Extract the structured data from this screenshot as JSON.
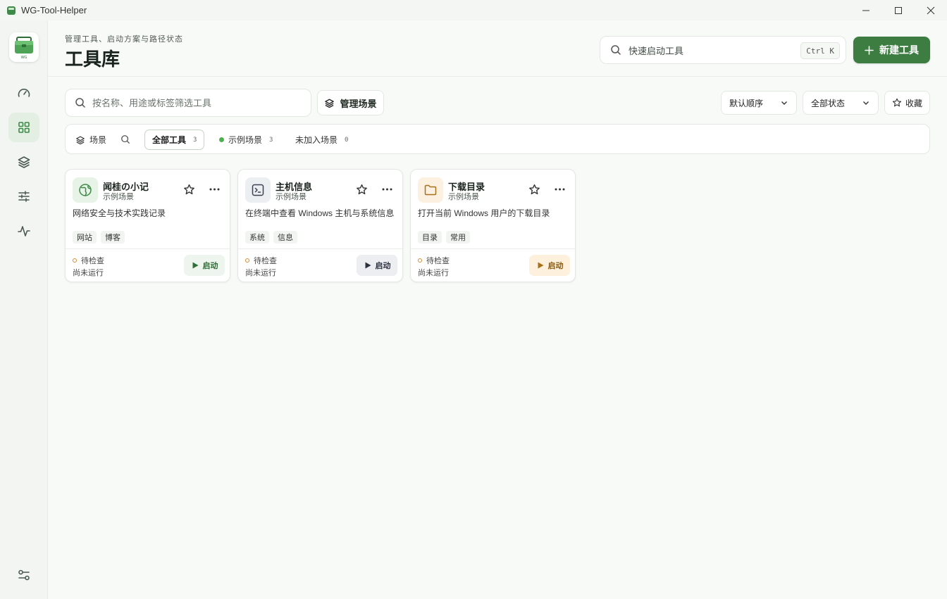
{
  "window": {
    "title": "WG-Tool-Helper"
  },
  "sidebar": {
    "logo_text": "WG"
  },
  "header": {
    "subtitle": "管理工具、启动方案与路径状态",
    "title": "工具库",
    "quick_search": {
      "placeholder": "快速启动工具",
      "shortcut": "Ctrl K"
    },
    "new_tool_label": "新建工具"
  },
  "filters": {
    "search_placeholder": "按名称、用途或标签筛选工具",
    "manage_scenes_label": "管理场景",
    "sort_value": "默认顺序",
    "status_value": "全部状态",
    "favorites_label": "收藏"
  },
  "scene_bar": {
    "label": "场景",
    "chips": [
      {
        "label": "全部工具",
        "count": "3"
      },
      {
        "label": "示例场景",
        "count": "3"
      },
      {
        "label": "未加入场景",
        "count": "0"
      }
    ]
  },
  "cards": [
    {
      "name": "闻桂の小记",
      "scene": "示例场景",
      "desc": "网络安全与技术实践记录",
      "tags": [
        "网站",
        "博客"
      ],
      "status": "待检查",
      "run_state": "尚未运行",
      "launch_label": "启动",
      "icon": "globe-icon",
      "accent": "#3f8a47"
    },
    {
      "name": "主机信息",
      "scene": "示例场景",
      "desc": "在终端中查看 Windows 主机与系统信息",
      "tags": [
        "系统",
        "信息"
      ],
      "status": "待检查",
      "run_state": "尚未运行",
      "launch_label": "启动",
      "icon": "terminal-icon",
      "accent": "#3a4150"
    },
    {
      "name": "下载目录",
      "scene": "示例场景",
      "desc": "打开当前 Windows 用户的下载目录",
      "tags": [
        "目录",
        "常用"
      ],
      "status": "待检查",
      "run_state": "尚未运行",
      "launch_label": "启动",
      "icon": "folder-icon",
      "accent": "#a8701c"
    }
  ],
  "colors": {
    "primary": "#3e7d42",
    "active_nav": "#3b8a45",
    "pending_status": "#d98a2b"
  }
}
